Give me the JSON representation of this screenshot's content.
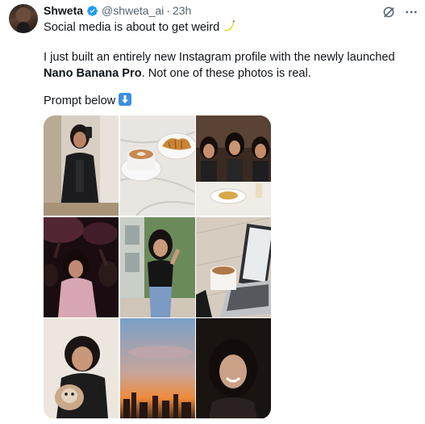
{
  "tweet": {
    "display_name": "Shweta",
    "handle": "@shweta_ai",
    "separator": "·",
    "time": "23h",
    "line1": "Social media is about to get weird",
    "line2_a": "I just built an entirely new Instagram profile with the newly launched ",
    "line2_bold": "Nano Banana Pro",
    "line2_b": ". Not one of these photos is real.",
    "line3": "Prompt below"
  },
  "icons": {
    "verified": "verified-badge-icon",
    "grok": "grok-icon",
    "more": "more-icon",
    "banana": "banana-emoji",
    "down_arrow": "down-arrow-emoji"
  },
  "colors": {
    "verified_blue": "#1d9bf0",
    "text": "#0f1419",
    "secondary": "#536471"
  },
  "photos": [
    "mirror-selfie-blazer",
    "latte-croissant-table",
    "friends-dinner-toast",
    "concert-crowd",
    "outdoor-pose-jeans",
    "coffee-laptop",
    "selfie-with-dog",
    "city-sunset",
    "smiling-portrait"
  ]
}
